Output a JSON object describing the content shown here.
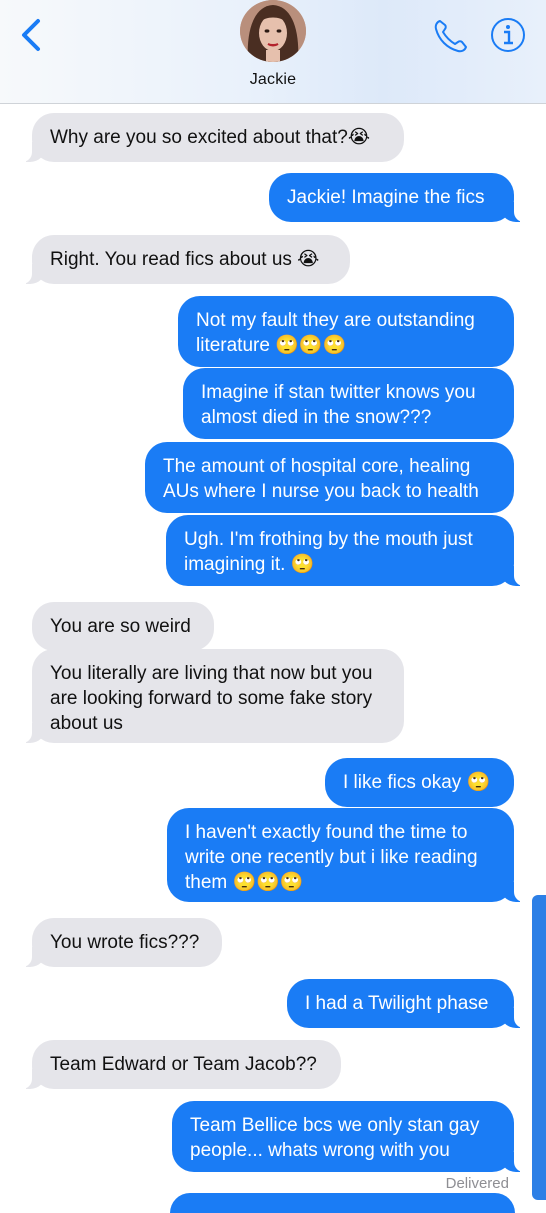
{
  "header": {
    "contact_name": "Jackie",
    "icons": {
      "back": "chevron-left-icon",
      "phone": "phone-icon",
      "info": "info-icon"
    },
    "accent_color": "#1a7cf5"
  },
  "messages": [
    {
      "side": "in",
      "lines": [
        "Why are you so excited about that?😭"
      ]
    },
    {
      "side": "out",
      "lines": [
        "Jackie! Imagine the fics"
      ]
    },
    {
      "side": "in",
      "lines": [
        "Right. You read fics about us 😭"
      ]
    },
    {
      "side": "out",
      "lines": [
        "Not my fault they are outstanding",
        "literature 🙄🙄🙄"
      ]
    },
    {
      "side": "out",
      "lines": [
        "Imagine if stan twitter knows you",
        "almost died in the snow???"
      ]
    },
    {
      "side": "out",
      "lines": [
        "The amount of hospital core, healing",
        "AUs where I nurse you back to health"
      ]
    },
    {
      "side": "out",
      "lines": [
        "Ugh. I'm frothing by the mouth just",
        "imagining it. 🙄"
      ]
    },
    {
      "side": "in",
      "lines": [
        "You are so weird"
      ]
    },
    {
      "side": "in",
      "lines": [
        "You literally are living that now but you",
        "are looking forward to some fake story",
        "about us"
      ]
    },
    {
      "side": "out",
      "lines": [
        "I like fics okay 🙄"
      ]
    },
    {
      "side": "out",
      "lines": [
        "I haven't exactly found the time to",
        "write one recently but i like reading",
        "them 🙄🙄🙄"
      ]
    },
    {
      "side": "in",
      "lines": [
        "You wrote fics???"
      ]
    },
    {
      "side": "out",
      "lines": [
        "I had a Twilight phase"
      ]
    },
    {
      "side": "in",
      "lines": [
        "Team Edward or Team Jacob??"
      ]
    },
    {
      "side": "out",
      "lines": [
        "Team Bellice bcs we only stan gay",
        "people... whats wrong with you"
      ]
    }
  ],
  "status": "Delivered"
}
